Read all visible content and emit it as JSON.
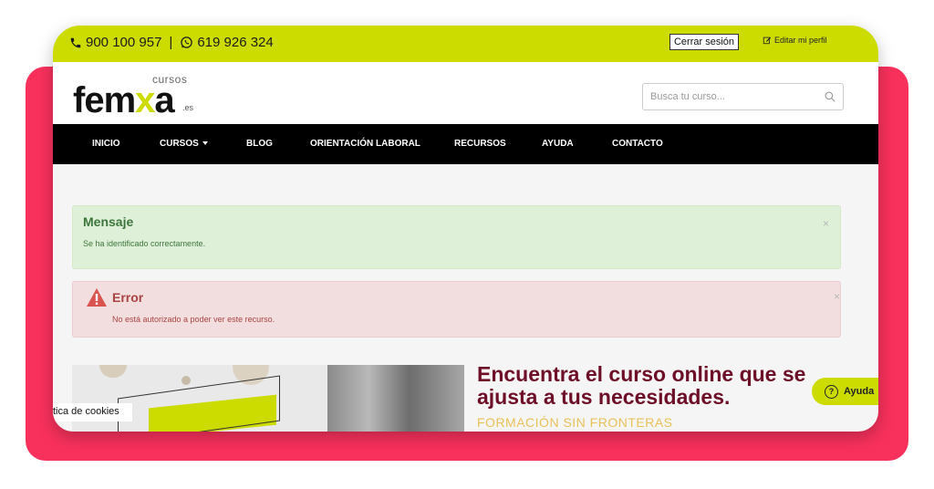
{
  "topbar": {
    "phone": "900 100 957",
    "separator": "|",
    "whatsapp": "619 926 324",
    "logout_label": "Cerrar sesión",
    "edit_profile_label": "Editar mi perfil"
  },
  "header": {
    "logo_small": "cursos",
    "logo_prefix": "fem",
    "logo_x": "x",
    "logo_suffix": "a",
    "logo_tld": ".es",
    "search_placeholder": "Busca tu curso..."
  },
  "nav": {
    "items": [
      "INICIO",
      "CURSOS",
      "BLOG",
      "ORIENTACIÓN LABORAL",
      "RECURSOS",
      "AYUDA",
      "CONTACTO"
    ]
  },
  "alerts": {
    "success": {
      "title": "Mensaje",
      "text": "Se ha identificado correctamente.",
      "close": "×"
    },
    "error": {
      "title": "Error",
      "text": "No está autorizado a poder ver este recurso.",
      "close": "×"
    }
  },
  "hero": {
    "title": "Encuentra el curso online que se ajusta a tus necesidades.",
    "subtitle": "FORMACIÓN SIN FRONTERAS"
  },
  "cookie_tab": "tica de cookies",
  "help_button": "Ayuda",
  "colors": {
    "accent": "#cddc00",
    "frame": "#f8315c",
    "hero_title": "#6e0f28"
  }
}
